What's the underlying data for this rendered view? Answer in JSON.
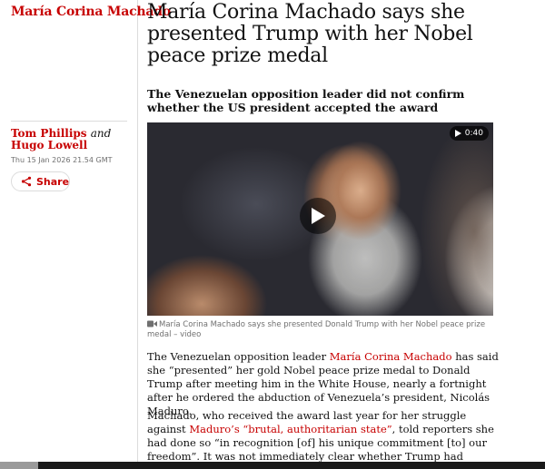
{
  "section": {
    "kicker": "María Corina Machado"
  },
  "article": {
    "headline": "María Corina Machado says she presented Trump with her Nobel peace prize medal",
    "standfirst": "The Venezuelan opposition leader did not confirm whether the US president accepted the award",
    "byline": {
      "author1": "Tom Phillips",
      "and": "and",
      "author2": "Hugo Lowell"
    },
    "date": "Thu 15 Jan 2026 21.54 GMT",
    "share_label": "Share",
    "video": {
      "duration": "0:40",
      "caption": "María Corina Machado says she presented Donald Trump with her Nobel peace prize medal – video"
    },
    "paragraph1": {
      "t1": "The Venezuelan opposition leader ",
      "link1": "María Corina Machado",
      "t2": " has said she “presented” her gold Nobel peace prize medal to Donald Trump after meeting him in the White House, nearly a fortnight after he ordered the abduction of Venezuela’s president, Nicolás Maduro."
    },
    "paragraph2": {
      "t1": "Machado, who received the award last year for her struggle against ",
      "link1": "Maduro’s “brutal, authoritarian state”",
      "t2": ", told reporters she had done so “in recognition [of] his unique commitment [to] our freedom”. It was not immediately clear whether Trump had accepted the gift."
    }
  },
  "colors": {
    "accent": "#c70000",
    "text": "#121212",
    "muted": "#707070",
    "rule": "#dcdcdc"
  },
  "icons": [
    "share-icon",
    "play-icon",
    "video-camera-icon"
  ]
}
